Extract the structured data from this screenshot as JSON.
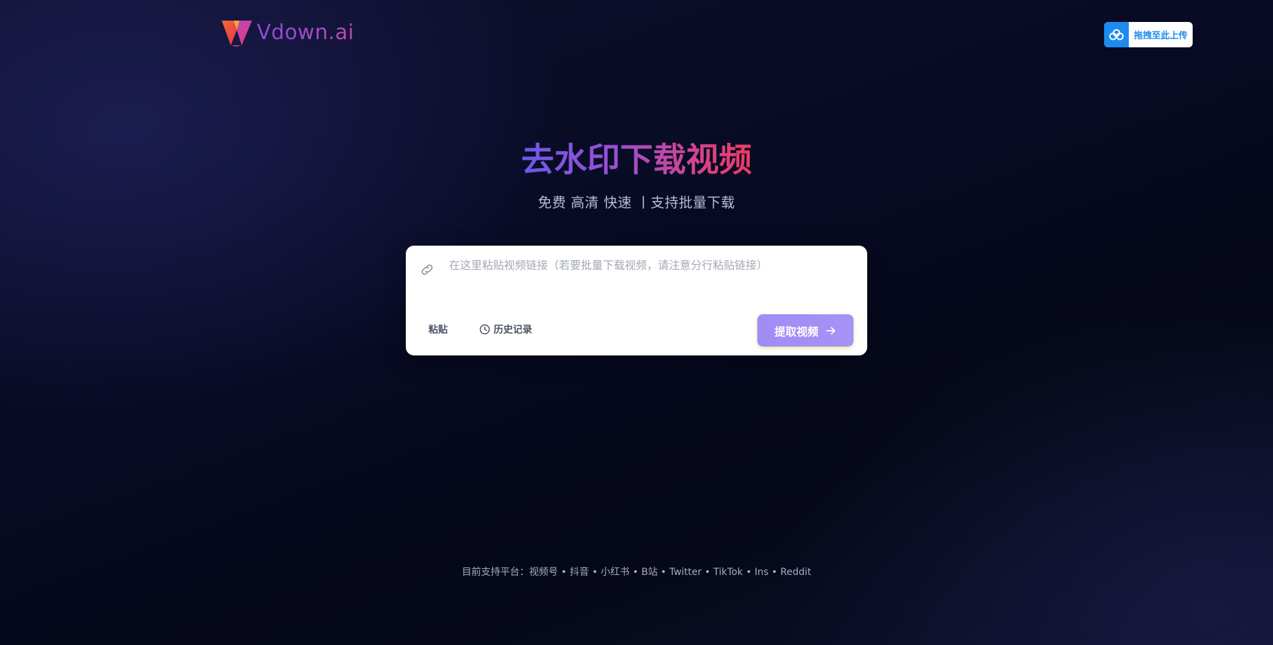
{
  "header": {
    "brand_name": "Vdown.ai",
    "upload_label": "拖拽至此上传"
  },
  "hero": {
    "title": "去水印下载视频",
    "subtitle": "免费 高清 快速 丨支持批量下载"
  },
  "input_card": {
    "placeholder": "在这里粘贴视频链接（若要批量下载视频，请注意分行粘贴链接）",
    "value": "",
    "paste_label": "粘贴",
    "history_label": "历史记录",
    "submit_label": "提取视频"
  },
  "footer": {
    "platforms_text": "目前支持平台：视频号 • 抖音 • 小红书 • B站 • Twitter • TikTok • Ins • Reddit"
  },
  "colors": {
    "background": "#070a22",
    "brand_gradient_start": "#8b4bd8",
    "brand_gradient_end": "#c04aa8",
    "title_gradient_start": "#6b5ae6",
    "title_gradient_end": "#ef3a62",
    "upload_accent": "#1e8bf0",
    "submit_button": "#a08cf5"
  },
  "icons": {
    "logo": "v-logo-icon",
    "upload": "cloud-upload-icon",
    "link": "link-icon",
    "history": "clock-icon",
    "submit": "arrow-right-icon"
  }
}
